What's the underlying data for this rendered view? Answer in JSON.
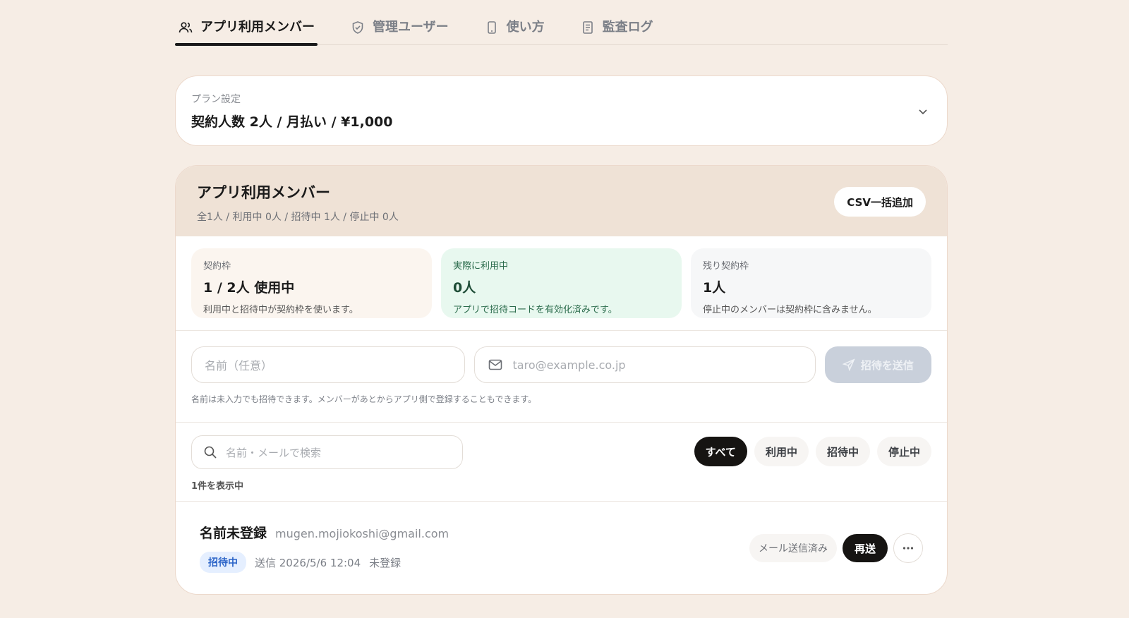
{
  "tabs": [
    {
      "label": "アプリ利用メンバー",
      "icon": "users-icon",
      "active": true
    },
    {
      "label": "管理ユーザー",
      "icon": "shield-icon"
    },
    {
      "label": "使い方",
      "icon": "phone-icon"
    },
    {
      "label": "監査ログ",
      "icon": "document-icon"
    }
  ],
  "plan": {
    "caption": "プラン設定",
    "value": "契約人数 2人 / 月払い / ¥1,000"
  },
  "members_card": {
    "title": "アプリ利用メンバー",
    "summary": "全1人 / 利用中 0人 / 招待中 1人 / 停止中 0人",
    "csv_button": "CSV一括追加"
  },
  "stats": [
    {
      "key": "契約枠",
      "value": "1 / 2人 使用中",
      "desc": "利用中と招待中が契約枠を使います。"
    },
    {
      "key": "実際に利用中",
      "value": "0人",
      "desc": "アプリで招待コードを有効化済みです。"
    },
    {
      "key": "残り契約枠",
      "value": "1人",
      "desc": "停止中のメンバーは契約枠に含みません。"
    }
  ],
  "invite": {
    "name_placeholder": "名前（任意）",
    "email_placeholder": "taro@example.co.jp",
    "send_label": "招待を送信",
    "hint": "名前は未入力でも招待できます。メンバーがあとからアプリ側で登録することもできます。"
  },
  "filter": {
    "search_placeholder": "名前・メールで検索",
    "count": "1件を表示中",
    "pills": [
      "すべて",
      "利用中",
      "招待中",
      "停止中"
    ],
    "active_pill": "すべて"
  },
  "member": {
    "name": "名前未登録",
    "email": "mugen.mojiokoshi@gmail.com",
    "badge": "招待中",
    "sent": "送信 2026/5/6 12:04",
    "reg_status": "未登録",
    "mail_status": "メール送信済み",
    "resend_label": "再送"
  },
  "colors": {
    "background": "#f6ede5",
    "accent_dark": "#161412",
    "badge_blue": "#2b64c8",
    "active_green_bg": "#e8f8ef"
  }
}
